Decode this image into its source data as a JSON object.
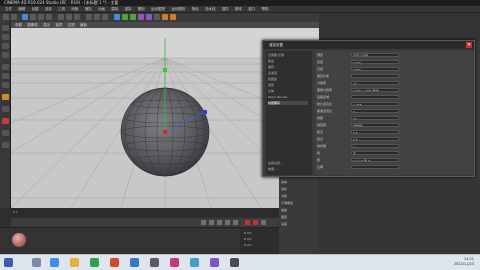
{
  "window": {
    "title": "CINEMA 4D R19.024 Studio (RC - R19) - [未标题 1 *] - 主要"
  },
  "menu": [
    "文件",
    "编辑",
    "创建",
    "选择",
    "工具",
    "网格",
    "捕捉",
    "动画",
    "模拟",
    "渲染",
    "雕刻",
    "运动跟踪",
    "运动图形",
    "角色",
    "流水线",
    "插件",
    "脚本",
    "窗口",
    "帮助"
  ],
  "viewport": {
    "tabs": [
      "查看",
      "摄像机",
      "显示",
      "选项",
      "过滤",
      "面板"
    ]
  },
  "popup": {
    "title": "渲染设置",
    "side_items": [
      "渲染器 标准",
      "输出",
      "保存",
      "多通道",
      "抗锯齿",
      "选项",
      "立体",
      "Team Render",
      "材质覆写",
      "效果...",
      "渲染设置..."
    ],
    "selected_side": "材质覆写",
    "rows": [
      {
        "label": "预置",
        "value": "自定义设置"
      },
      {
        "label": "宽度",
        "value": "1920"
      },
      {
        "label": "高度",
        "value": "1080"
      },
      {
        "label": "锁定比率",
        "value": ""
      },
      {
        "label": "分辨率",
        "value": "72"
      },
      {
        "label": "图像分辨率",
        "value": "1920 x 1080 像素"
      },
      {
        "label": "渲染区域",
        "value": ""
      },
      {
        "label": "胶片宽高比",
        "value": "1.778"
      },
      {
        "label": "像素宽高比",
        "value": "1"
      },
      {
        "label": "帧频",
        "value": "30"
      },
      {
        "label": "帧范围",
        "value": "当前帧"
      },
      {
        "label": "起点",
        "value": "0 F"
      },
      {
        "label": "终点",
        "value": "0 F"
      },
      {
        "label": "帧步幅",
        "value": "1"
      },
      {
        "label": "场",
        "value": "无"
      },
      {
        "label": "帧",
        "value": "1 (从 0 到 0)"
      },
      {
        "label": "注释",
        "value": ""
      }
    ]
  },
  "strip": [
    "基本",
    "坐标",
    "对象",
    "平滑着色",
    "缩放",
    "图层",
    "渲染"
  ],
  "coords": {
    "x": "0 cm",
    "y": "0 cm",
    "z": "0 cm",
    "apply": "应用"
  },
  "timeline": {
    "start": "0 F",
    "end": "90 F"
  },
  "taskbar": {
    "time": "14:21",
    "date": "2022/11/23"
  },
  "colors": {
    "accent": "#4c86d8",
    "viewport_bg": "#c8c8c8",
    "popup_bg": "#3b3b3b"
  },
  "icons": [
    "cinema4d-icon",
    "move-icon",
    "scale-icon",
    "rotate-icon",
    "cube-icon",
    "sphere-icon",
    "light-icon",
    "camera-icon",
    "render-icon",
    "close-icon",
    "play-icon",
    "record-icon",
    "windows-start-icon",
    "browser-icon"
  ]
}
